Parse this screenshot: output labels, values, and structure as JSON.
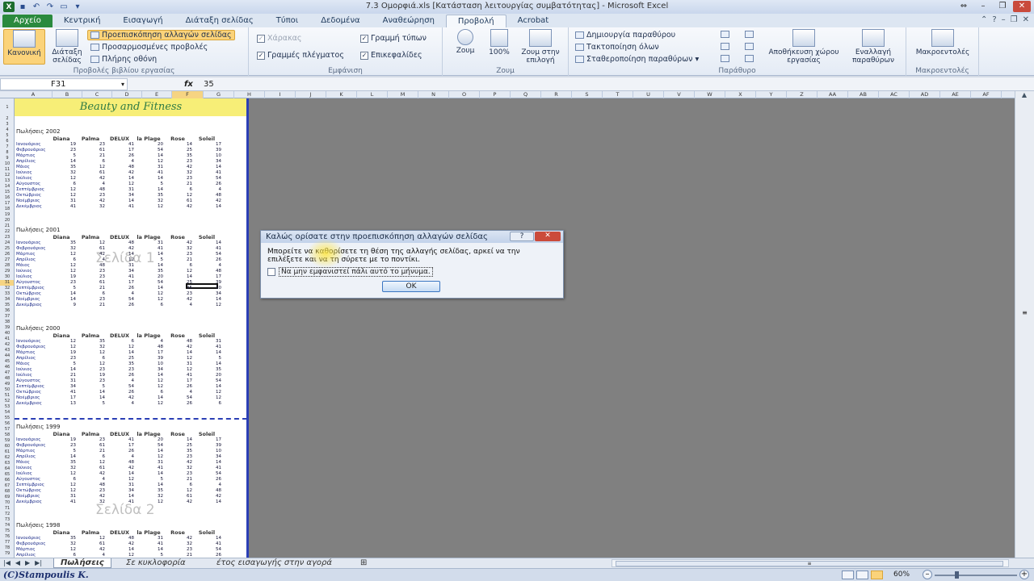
{
  "window": {
    "title": "7.3 Ομορφιά.xls [Κατάσταση λειτουργίας συμβατότητας] - Microsoft Excel"
  },
  "ribbon_tabs": [
    "Αρχείο",
    "Κεντρική",
    "Εισαγωγή",
    "Διάταξη σελίδας",
    "Τύποι",
    "Δεδομένα",
    "Αναθεώρηση",
    "Προβολή",
    "Acrobat"
  ],
  "ribbon": {
    "views_group": {
      "label": "Προβολές βιβλίου εργασίας",
      "normal": "Κανονική",
      "page_layout": "Διάταξη σελίδας",
      "page_break_preview": "Προεπισκόπηση αλλαγών σελίδας",
      "custom_views": "Προσαρμοσμένες προβολές",
      "full_screen": "Πλήρης οθόνη"
    },
    "show_group": {
      "label": "Εμφάνιση",
      "ruler": "Χάρακας",
      "gridlines": "Γραμμές πλέγματος",
      "formula_bar": "Γραμμή τύπων",
      "headings": "Επικεφαλίδες"
    },
    "zoom_group": {
      "label": "Ζουμ",
      "zoom": "Ζουμ",
      "hundred": "100%",
      "zoom_selection": "Ζουμ στην επιλογή"
    },
    "window_group": {
      "label": "Παράθυρο",
      "new_window": "Δημιουργία παραθύρου",
      "arrange_all": "Τακτοποίηση όλων",
      "freeze_panes": "Σταθεροποίηση παραθύρων",
      "save_workspace": "Αποθήκευση χώρου εργασίας",
      "switch_windows": "Εναλλαγή παραθύρων"
    },
    "macros_group": {
      "label": "Μακροεντολές",
      "macros": "Μακροεντολές"
    }
  },
  "formula_bar": {
    "name_box": "F31",
    "fx": "fx",
    "value": "35"
  },
  "columns": [
    "A",
    "B",
    "C",
    "D",
    "E",
    "F",
    "G",
    "H",
    "I",
    "J",
    "K",
    "L",
    "M",
    "N",
    "O",
    "P",
    "Q",
    "R",
    "S",
    "T",
    "U",
    "V",
    "W",
    "X",
    "Y",
    "Z",
    "AA",
    "AB",
    "AC",
    "AD",
    "AE",
    "AF"
  ],
  "sheet": {
    "title": "Beauty and Fitness",
    "brands": [
      "Diana",
      "Palma",
      "DELUX",
      "la Plage",
      "Rose",
      "Soleil"
    ],
    "watermark1": "Σελίδα 1",
    "watermark2": "Σελίδα 2",
    "sections": [
      {
        "title": "Πωλήσεις 2002",
        "rows": [
          [
            "Ιανουάριος",
            "19",
            "23",
            "41",
            "20",
            "14",
            "17"
          ],
          [
            "Φεβρουάριος",
            "23",
            "61",
            "17",
            "54",
            "25",
            "39"
          ],
          [
            "Μάρτιος",
            "5",
            "21",
            "26",
            "14",
            "35",
            "10"
          ],
          [
            "Απρίλιος",
            "14",
            "6",
            "4",
            "12",
            "23",
            "34"
          ],
          [
            "Μάιος",
            "35",
            "12",
            "48",
            "31",
            "42",
            "14"
          ],
          [
            "Ιούνιος",
            "32",
            "61",
            "42",
            "41",
            "32",
            "41"
          ],
          [
            "Ιούλιος",
            "12",
            "42",
            "14",
            "14",
            "23",
            "54"
          ],
          [
            "Αύγουστος",
            "6",
            "4",
            "12",
            "5",
            "21",
            "26"
          ],
          [
            "Σεπτέμβριος",
            "12",
            "48",
            "31",
            "14",
            "6",
            "4"
          ],
          [
            "Οκτώβριος",
            "12",
            "23",
            "34",
            "35",
            "12",
            "48"
          ],
          [
            "Νοέμβριος",
            "31",
            "42",
            "14",
            "32",
            "61",
            "42"
          ],
          [
            "Δεκέμβριος",
            "41",
            "32",
            "41",
            "12",
            "42",
            "14"
          ]
        ]
      },
      {
        "title": "Πωλήσεις 2001",
        "rows": [
          [
            "Ιανουάριος",
            "35",
            "12",
            "48",
            "31",
            "42",
            "14"
          ],
          [
            "Φεβρουάριος",
            "32",
            "61",
            "42",
            "41",
            "32",
            "41"
          ],
          [
            "Μάρτιος",
            "12",
            "42",
            "14",
            "14",
            "23",
            "54"
          ],
          [
            "Απρίλιος",
            "6",
            "4",
            "12",
            "5",
            "21",
            "26"
          ],
          [
            "Μάιος",
            "12",
            "48",
            "31",
            "14",
            "6",
            "4"
          ],
          [
            "Ιούνιος",
            "12",
            "23",
            "34",
            "35",
            "12",
            "48"
          ],
          [
            "Ιούλιος",
            "19",
            "23",
            "41",
            "20",
            "14",
            "17"
          ],
          [
            "Αύγουστος",
            "23",
            "61",
            "17",
            "54",
            "25",
            "39"
          ],
          [
            "Σεπτέμβριος",
            "5",
            "21",
            "26",
            "14",
            "35",
            "10"
          ],
          [
            "Οκτώβριος",
            "14",
            "6",
            "4",
            "12",
            "23",
            "34"
          ],
          [
            "Νοέμβριος",
            "14",
            "23",
            "54",
            "12",
            "42",
            "14"
          ],
          [
            "Δεκέμβριος",
            "9",
            "21",
            "26",
            "6",
            "4",
            "12"
          ]
        ]
      },
      {
        "title": "Πωλήσεις 2000",
        "rows": [
          [
            "Ιανουάριος",
            "12",
            "35",
            "6",
            "4",
            "48",
            "31"
          ],
          [
            "Φεβρουάριος",
            "12",
            "32",
            "12",
            "48",
            "42",
            "41"
          ],
          [
            "Μάρτιος",
            "19",
            "12",
            "14",
            "17",
            "14",
            "14"
          ],
          [
            "Απρίλιος",
            "23",
            "6",
            "25",
            "39",
            "12",
            "5"
          ],
          [
            "Μάιος",
            "5",
            "12",
            "35",
            "10",
            "31",
            "14"
          ],
          [
            "Ιούνιος",
            "14",
            "23",
            "23",
            "34",
            "12",
            "35"
          ],
          [
            "Ιούλιος",
            "21",
            "19",
            "26",
            "14",
            "41",
            "20"
          ],
          [
            "Αύγουστος",
            "31",
            "23",
            "4",
            "12",
            "17",
            "54"
          ],
          [
            "Σεπτέμβριος",
            "34",
            "5",
            "54",
            "12",
            "26",
            "14"
          ],
          [
            "Οκτώβριος",
            "41",
            "14",
            "26",
            "6",
            "4",
            "12"
          ],
          [
            "Νοέμβριος",
            "17",
            "14",
            "42",
            "14",
            "54",
            "12"
          ],
          [
            "Δεκέμβριος",
            "13",
            "5",
            "4",
            "12",
            "26",
            "6"
          ]
        ]
      },
      {
        "title": "Πωλήσεις 1999",
        "rows": [
          [
            "Ιανουάριος",
            "19",
            "23",
            "41",
            "20",
            "14",
            "17"
          ],
          [
            "Φεβρουάριος",
            "23",
            "61",
            "17",
            "54",
            "25",
            "39"
          ],
          [
            "Μάρτιος",
            "5",
            "21",
            "26",
            "14",
            "35",
            "10"
          ],
          [
            "Απρίλιος",
            "14",
            "6",
            "4",
            "12",
            "23",
            "34"
          ],
          [
            "Μάιος",
            "35",
            "12",
            "48",
            "31",
            "42",
            "14"
          ],
          [
            "Ιούνιος",
            "32",
            "61",
            "42",
            "41",
            "32",
            "41"
          ],
          [
            "Ιούλιος",
            "12",
            "42",
            "14",
            "14",
            "23",
            "54"
          ],
          [
            "Αύγουστος",
            "6",
            "4",
            "12",
            "5",
            "21",
            "26"
          ],
          [
            "Σεπτέμβριος",
            "12",
            "48",
            "31",
            "14",
            "6",
            "4"
          ],
          [
            "Οκτώβριος",
            "12",
            "23",
            "34",
            "35",
            "12",
            "48"
          ],
          [
            "Νοέμβριος",
            "31",
            "42",
            "14",
            "32",
            "61",
            "42"
          ],
          [
            "Δεκέμβριος",
            "41",
            "32",
            "41",
            "12",
            "42",
            "14"
          ]
        ]
      },
      {
        "title": "Πωλήσεις 1998",
        "rows": [
          [
            "Ιανουάριος",
            "35",
            "12",
            "48",
            "31",
            "42",
            "14"
          ],
          [
            "Φεβρουάριος",
            "32",
            "61",
            "42",
            "41",
            "32",
            "41"
          ],
          [
            "Μάρτιος",
            "12",
            "42",
            "14",
            "14",
            "23",
            "54"
          ],
          [
            "Απρίλιος",
            "6",
            "4",
            "12",
            "5",
            "21",
            "26"
          ]
        ]
      }
    ]
  },
  "dialog": {
    "title": "Καλώς ορίσατε στην προεπισκόπηση αλλαγών σελίδας",
    "help": "?",
    "close": "✕",
    "message": "Μπορείτε να καθορίσετε τη θέση της αλλαγής σελίδας, αρκεί να την επιλέξετε και να τη σύρετε με το ποντίκι.",
    "checkbox": "Να μην εμφανιστεί πάλι αυτό το μήνυμα.",
    "ok": "OK"
  },
  "sheet_tabs": [
    "Πωλήσεις",
    "Σε κυκλοφορία",
    "έτος εισαγωγής στην αγορά"
  ],
  "status": {
    "credit": "(C)Stampoulis K.",
    "zoom": "60%"
  },
  "colors": {
    "title_fill": "#f7ee77",
    "title_text": "#2d7a45",
    "page_break": "#2b3fb5",
    "file_tab": "#2a8a3e"
  }
}
